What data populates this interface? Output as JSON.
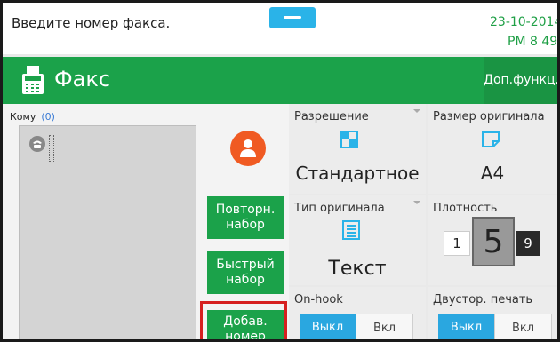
{
  "status": {
    "message": "Введите номер факса.",
    "date": "23-10-2014",
    "time": "PM 8  49"
  },
  "header": {
    "title": "Факс",
    "extra_functions": "Доп.функц."
  },
  "recipients": {
    "label": "Кому",
    "count": "(0)"
  },
  "actions": {
    "redial": "Повторн.\nнабор",
    "speed_dial": "Быстрый\nнабор",
    "add_number": "Добав.\nномер"
  },
  "settings": {
    "resolution": {
      "title": "Разрешение",
      "value": "Стандартное"
    },
    "original_size": {
      "title": "Размер оригинала",
      "value": "A4"
    },
    "original_type": {
      "title": "Тип оригинала",
      "value": "Текст"
    },
    "density": {
      "title": "Плотность",
      "low": "1",
      "current": "5",
      "high": "9"
    },
    "on_hook": {
      "title": "On-hook",
      "off": "Выкл",
      "on": "Вкл"
    },
    "duplex": {
      "title": "Двустор. печать",
      "off": "Выкл",
      "on": "Вкл"
    }
  },
  "colors": {
    "green": "#1ba24a",
    "blue": "#2ab3e8",
    "orange": "#f05a22",
    "highlight_red": "#d62020"
  }
}
